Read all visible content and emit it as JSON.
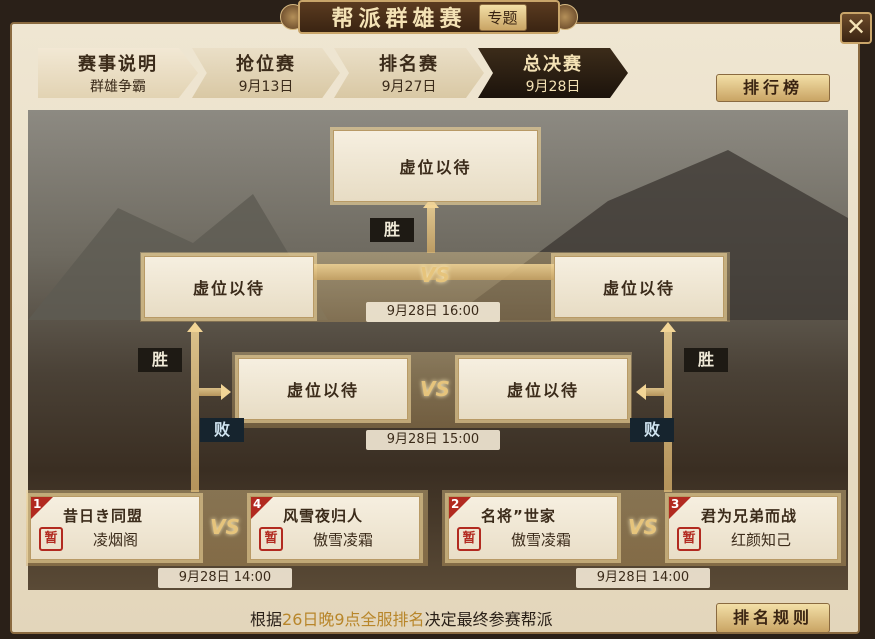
{
  "header": {
    "title": "帮派群雄赛",
    "badge": "专题",
    "close": "✕"
  },
  "tabs": [
    {
      "title": "赛事说明",
      "sub": "群雄争霸"
    },
    {
      "title": "抢位赛",
      "sub": "9月13日"
    },
    {
      "title": "排名赛",
      "sub": "9月27日"
    },
    {
      "title": "总决赛",
      "sub": "9月28日"
    }
  ],
  "rank_button": "排行榜",
  "bracket": {
    "final_slot": "虚位以待",
    "semi_left": "虚位以待",
    "semi_right": "虚位以待",
    "third_left": "虚位以待",
    "third_right": "虚位以待",
    "time_final": "9月28日  16:00",
    "time_third": "9月28日  15:00",
    "time_left": "9月28日  14:00",
    "time_right": "9月28日  14:00",
    "win": "胜",
    "lose": "败",
    "vs": "VS",
    "stamp": "暂"
  },
  "teams": [
    {
      "seed": "1",
      "name": "昔日き同盟",
      "leader": "凌烟阁"
    },
    {
      "seed": "4",
      "name": "风雪夜归人",
      "leader": "傲雪凌霜"
    },
    {
      "seed": "2",
      "name": "名将”世家",
      "leader": "傲雪凌霜"
    },
    {
      "seed": "3",
      "name": "君为兄弟而战",
      "leader": "红颜知己"
    }
  ],
  "footer": {
    "pre": "根据",
    "highlight": "26日晚9点全服排名",
    "post": "决定最终参赛帮派",
    "rule_button": "排名规则"
  }
}
